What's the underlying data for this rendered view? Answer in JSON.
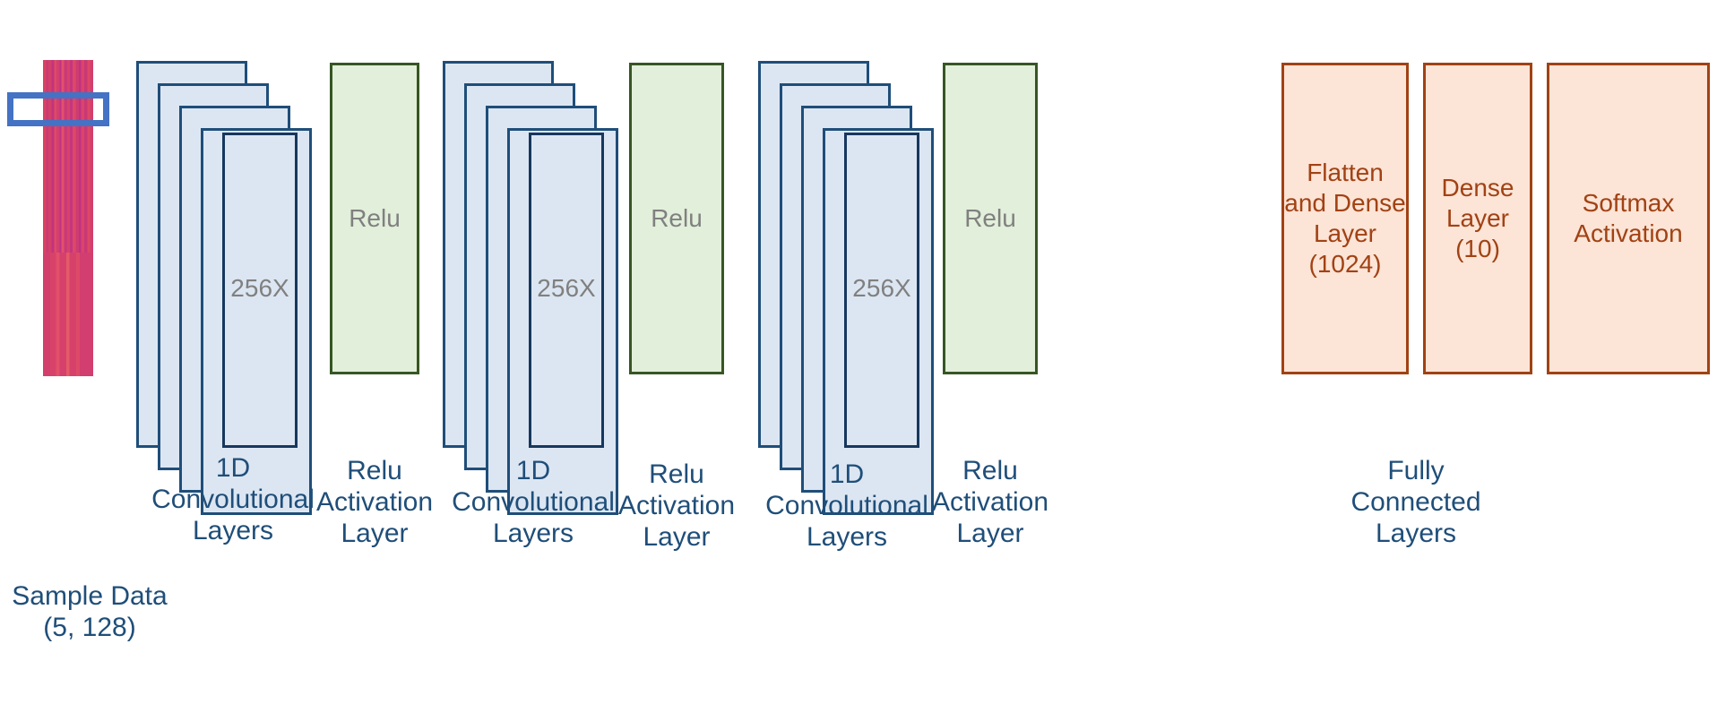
{
  "diagram": {
    "title": "1D Convolutional Neural Network Architecture",
    "background_color": "#ffffff"
  },
  "palette": {
    "conv_fill": "#dce6f2",
    "conv_border": "#1f4e79",
    "relu_fill": "#e2efda",
    "relu_border": "#375623",
    "dense_fill": "#fce4d6",
    "dense_border": "#a14214",
    "caption_color": "#1f4e79",
    "inner_label_gray": "#808080",
    "highlight_blue": "#4472c4",
    "heatmap_pink": "#d9425f",
    "heatmap_magenta": "#c2357e"
  },
  "input": {
    "name": "sample-data-heatmap",
    "caption": "Sample Data\n(5, 128)",
    "shape_rows": 5,
    "shape_cols": 128,
    "highlight_label": "selection-window"
  },
  "stages": [
    {
      "id": "conv1",
      "type": "conv-stack",
      "inner_label": "256X",
      "depth": 5,
      "caption": "1D\nConvolutional\nLayers"
    },
    {
      "id": "relu1",
      "type": "relu",
      "inner_label": "Relu",
      "caption": "Relu\nActivation\nLayer"
    },
    {
      "id": "conv2",
      "type": "conv-stack",
      "inner_label": "256X",
      "depth": 5,
      "caption": "1D\nConvolutional\nLayers"
    },
    {
      "id": "relu2",
      "type": "relu",
      "inner_label": "Relu",
      "caption": "Relu\nActivation\nLayer"
    },
    {
      "id": "conv3",
      "type": "conv-stack",
      "inner_label": "256X",
      "depth": 5,
      "caption": "1D\nConvolutional\nLayers"
    },
    {
      "id": "relu3",
      "type": "relu",
      "inner_label": "Relu",
      "caption": "Relu\nActivation\nLayer"
    },
    {
      "id": "flatten_dense",
      "type": "dense",
      "inner_label": "Flatten\nand\nDense\nLayer\n(1024)",
      "caption": ""
    },
    {
      "id": "dense_10",
      "type": "dense",
      "inner_label": "Dense\nLayer\n(10)",
      "caption": ""
    },
    {
      "id": "softmax",
      "type": "dense",
      "inner_label": "Softmax\nActivation",
      "caption": ""
    }
  ],
  "fully_connected_caption": "Fully\nConnected\nLayers"
}
